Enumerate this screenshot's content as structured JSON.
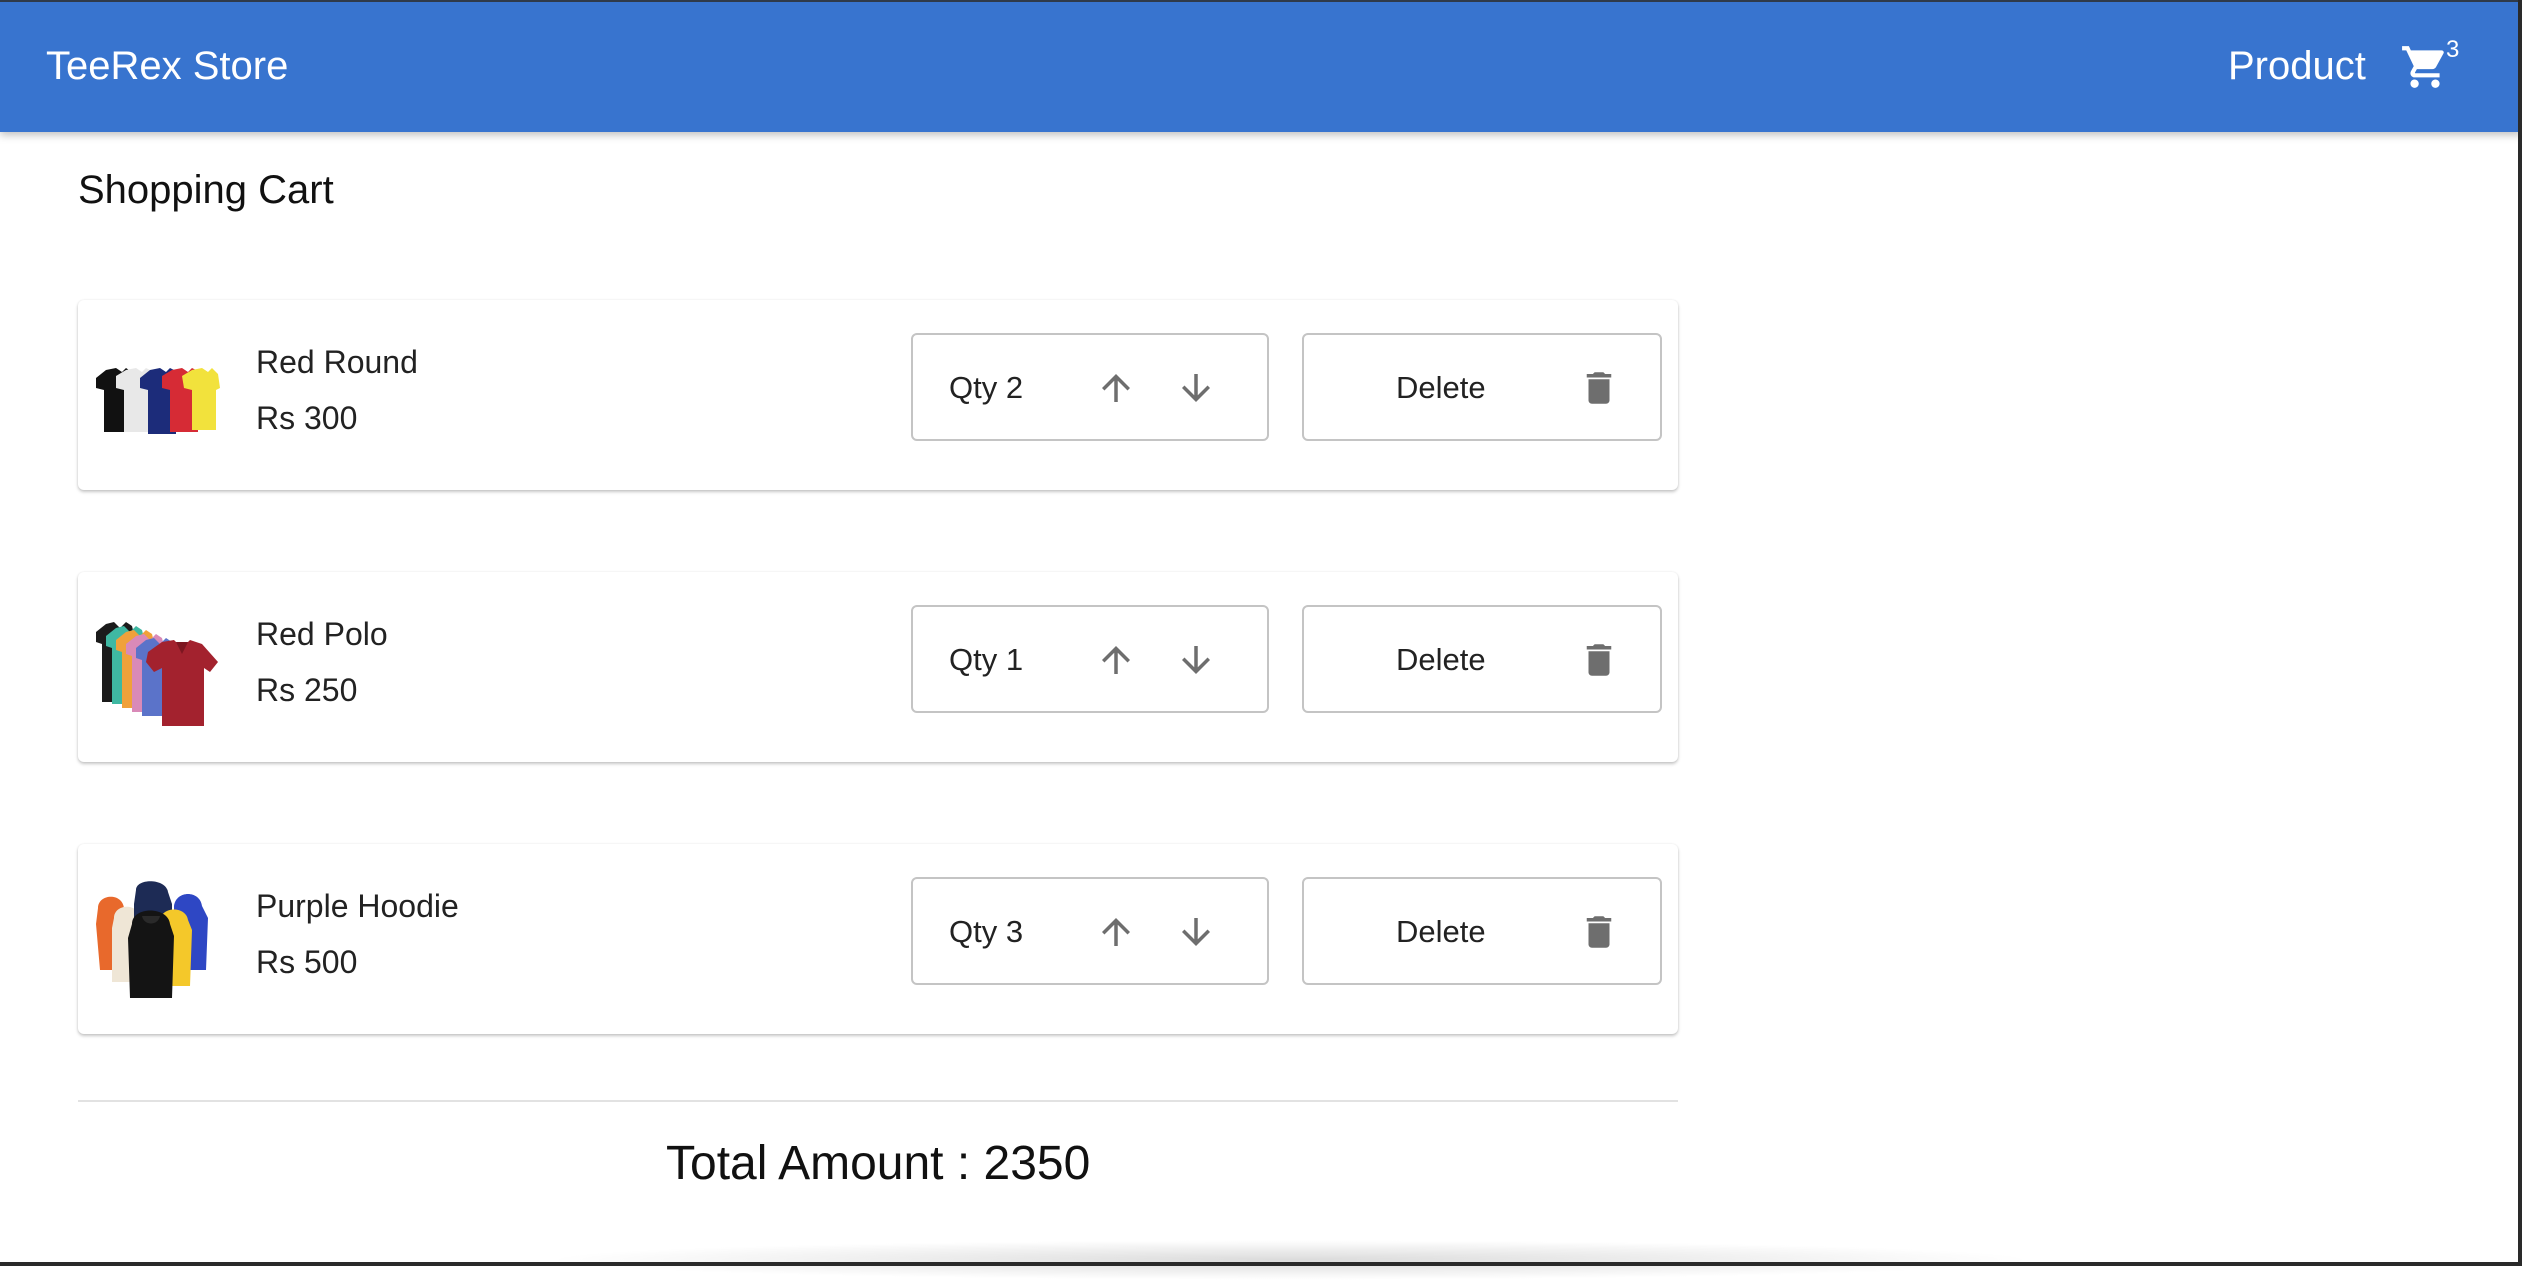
{
  "header": {
    "brand": "TeeRex Store",
    "nav_product": "Product",
    "cart_count": "3",
    "background_color": "#3874cf"
  },
  "page": {
    "title": "Shopping Cart"
  },
  "cart": {
    "items": [
      {
        "name": "Red Round",
        "price": "Rs 300",
        "qty_label": "Qty 2",
        "delete_label": "Delete",
        "thumbnail": "round-neck-tshirts-image"
      },
      {
        "name": "Red Polo",
        "price": "Rs 250",
        "qty_label": "Qty 1",
        "delete_label": "Delete",
        "thumbnail": "polo-shirts-image"
      },
      {
        "name": "Purple Hoodie",
        "price": "Rs 500",
        "qty_label": "Qty 3",
        "delete_label": "Delete",
        "thumbnail": "hoodies-image"
      }
    ],
    "total_label": "Total Amount : 2350"
  },
  "icons": {
    "cart": "shopping-cart-icon",
    "increase": "arrow-up-icon",
    "decrease": "arrow-down-icon",
    "delete": "trash-icon"
  }
}
